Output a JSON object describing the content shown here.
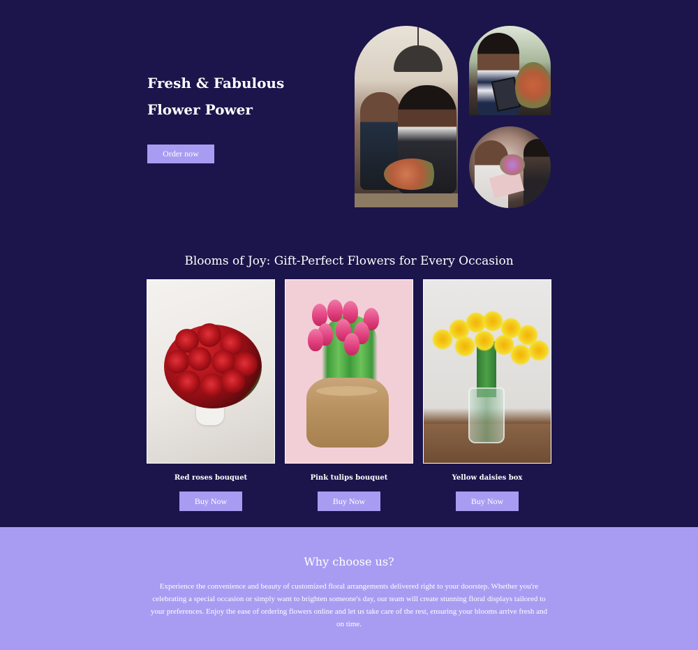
{
  "hero": {
    "title_line1": "Fresh & Fabulous",
    "title_line2": "Flower Power",
    "order_label": "Order now"
  },
  "gallery": {
    "icons": [
      "florists-photo",
      "florist-tablet-photo",
      "gift-delivery-photo"
    ]
  },
  "occasions": {
    "title": "Blooms of Joy: Gift-Perfect Flowers for Every Occasion",
    "products": [
      {
        "name": "Red roses bouquet",
        "button": "Buy Now"
      },
      {
        "name": "Pink tulips bouquet",
        "button": "Buy Now"
      },
      {
        "name": "Yellow daisies box",
        "button": "Buy Now"
      }
    ]
  },
  "why": {
    "title": "Why choose us?",
    "text": "Experience the convenience and beauty of customized floral arrangements delivered right to your doorstep. Whether you're celebrating a special occasion or simply want to brighten someone's day, our team will create stunning floral displays tailored to your preferences. Enjoy the ease of ordering flowers online and let us take care of the rest, ensuring your blooms arrive fresh and on time."
  },
  "colors": {
    "background": "#1b154b",
    "accent": "#a89cf2",
    "text": "#ffffff"
  }
}
